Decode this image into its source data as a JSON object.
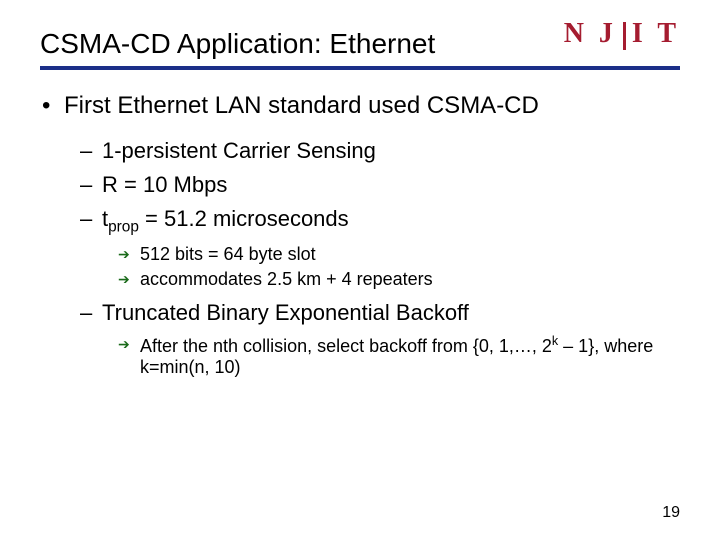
{
  "logo": {
    "text_left": "N J",
    "text_right": "I T"
  },
  "title": "CSMA-CD Application:  Ethernet",
  "bullets": {
    "main": "First Ethernet LAN standard used CSMA-CD",
    "sub1": "1-persistent Carrier Sensing",
    "sub2": "R = 10 Mbps",
    "sub3_pre": "t",
    "sub3_sub": "prop",
    "sub3_post": " = 51.2 microseconds",
    "sub3a": "512 bits = 64 byte slot",
    "sub3b": "accommodates 2.5 km + 4 repeaters",
    "sub4": "Truncated Binary Exponential Backoff",
    "sub4a_pre": "After the nth collision, select backoff from {0, 1,…, 2",
    "sub4a_sup": "k",
    "sub4a_post": " – 1}, where k=min(n, 10)"
  },
  "page_number": "19"
}
